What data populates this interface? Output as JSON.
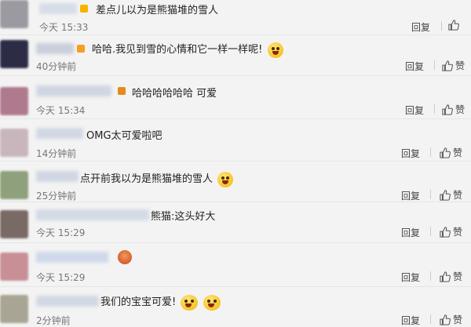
{
  "comments": [
    {
      "text": "差点儿以为是熊猫堆的雪人",
      "time": "今天 15:33",
      "reply": "回复",
      "like": ""
    },
    {
      "text": "哈哈.我见到雪的心情和它一样一样呢!",
      "time": "40分钟前",
      "reply": "回复",
      "like": "赞"
    },
    {
      "text": "哈哈哈哈哈哈 可爱",
      "time": "今天 15:34",
      "reply": "回复",
      "like": "赞"
    },
    {
      "text": "OMG太可爱啦吧",
      "time": "14分钟前",
      "reply": "回复",
      "like": "赞"
    },
    {
      "text": "点开前我以为是熊猫堆的雪人",
      "time": "25分钟前",
      "reply": "回复",
      "like": "赞"
    },
    {
      "text": "熊猫:这头好大",
      "time": "今天 15:29",
      "reply": "回复",
      "like": "赞"
    },
    {
      "text": "",
      "time": "今天 15:29",
      "reply": "回复",
      "like": "赞"
    },
    {
      "text": "我们的宝宝可爱!",
      "time": "2分钟前",
      "reply": "回复",
      "like": "赞"
    }
  ],
  "colors": {
    "background": "#f3f3f3",
    "divider": "#e6e6e6",
    "time_text": "#777777",
    "action_text": "#444444"
  },
  "icons": {
    "like": "thumbs-up-icon",
    "emoji": "laughing-emoji-icon",
    "gift": "gift-icon"
  }
}
